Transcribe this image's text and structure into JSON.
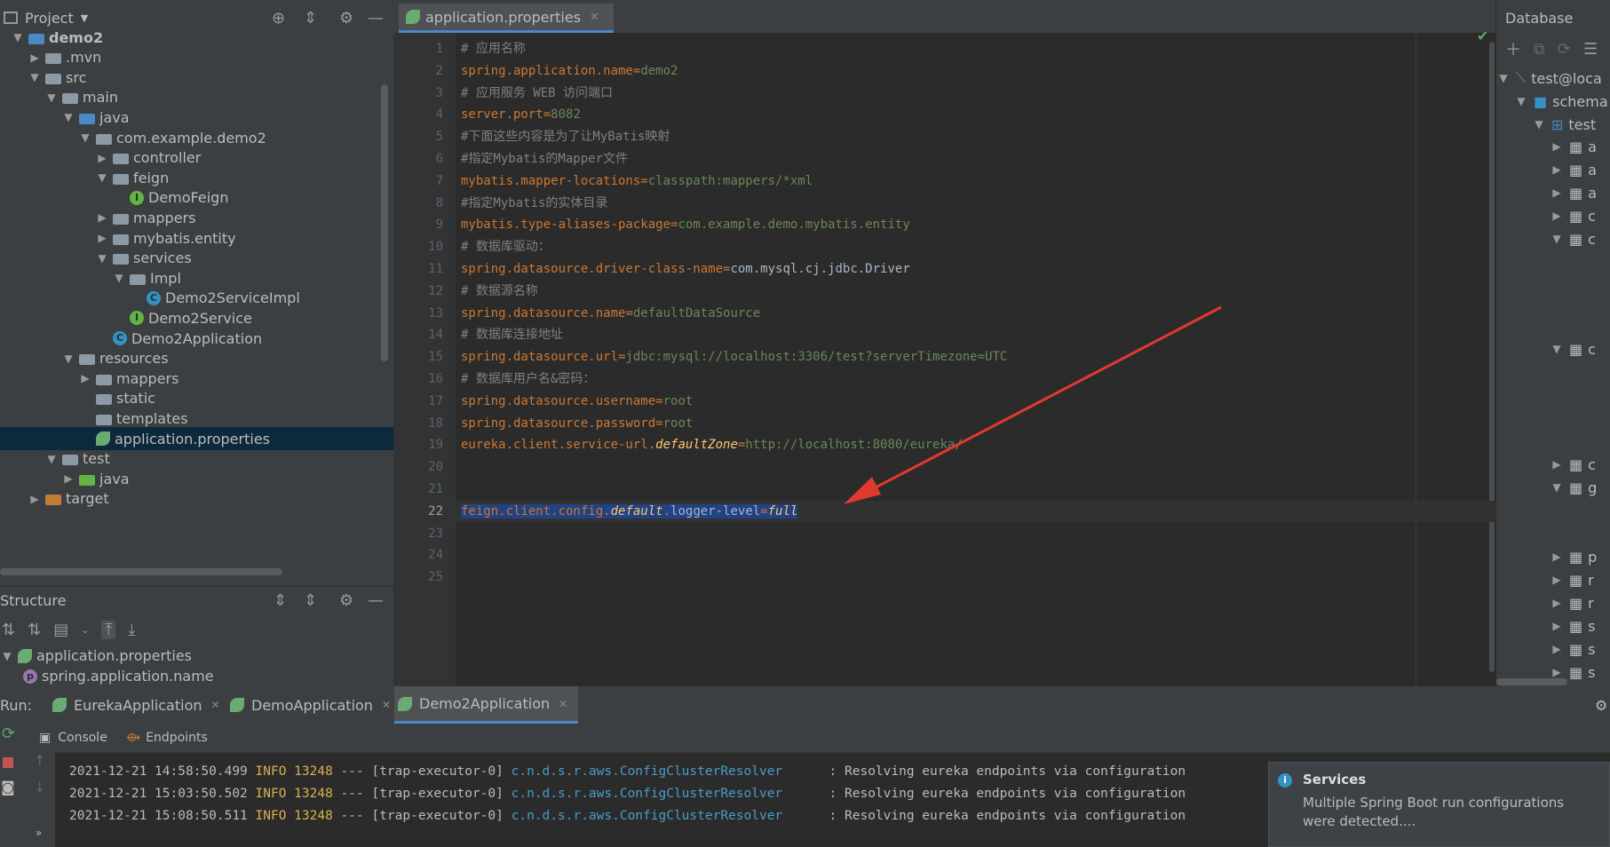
{
  "project": {
    "title": "Project",
    "tree": [
      {
        "label": "demo2",
        "indent": 0,
        "arrow": "down",
        "icon": "folder-blue",
        "bold": true
      },
      {
        "label": ".mvn",
        "indent": 1,
        "arrow": "right",
        "icon": "folder"
      },
      {
        "label": "src",
        "indent": 1,
        "arrow": "down",
        "icon": "folder"
      },
      {
        "label": "main",
        "indent": 2,
        "arrow": "down",
        "icon": "folder"
      },
      {
        "label": "java",
        "indent": 3,
        "arrow": "down",
        "icon": "folder-blue"
      },
      {
        "label": "com.example.demo2",
        "indent": 4,
        "arrow": "down",
        "icon": "package"
      },
      {
        "label": "controller",
        "indent": 5,
        "arrow": "right",
        "icon": "package"
      },
      {
        "label": "feign",
        "indent": 5,
        "arrow": "down",
        "icon": "package"
      },
      {
        "label": "DemoFeign",
        "indent": 6,
        "arrow": "",
        "icon": "interface"
      },
      {
        "label": "mappers",
        "indent": 5,
        "arrow": "right",
        "icon": "package"
      },
      {
        "label": "mybatis.entity",
        "indent": 5,
        "arrow": "right",
        "icon": "package"
      },
      {
        "label": "services",
        "indent": 5,
        "arrow": "down",
        "icon": "package"
      },
      {
        "label": "Impl",
        "indent": 6,
        "arrow": "down",
        "icon": "package"
      },
      {
        "label": "Demo2ServiceImpl",
        "indent": 7,
        "arrow": "",
        "icon": "class"
      },
      {
        "label": "Demo2Service",
        "indent": 6,
        "arrow": "",
        "icon": "interface"
      },
      {
        "label": "Demo2Application",
        "indent": 5,
        "arrow": "",
        "icon": "spring-class"
      },
      {
        "label": "resources",
        "indent": 3,
        "arrow": "down",
        "icon": "folder"
      },
      {
        "label": "mappers",
        "indent": 4,
        "arrow": "right",
        "icon": "folder"
      },
      {
        "label": "static",
        "indent": 4,
        "arrow": "",
        "icon": "folder"
      },
      {
        "label": "templates",
        "indent": 4,
        "arrow": "",
        "icon": "folder"
      },
      {
        "label": "application.properties",
        "indent": 4,
        "arrow": "",
        "icon": "spring-props",
        "selected": true
      },
      {
        "label": "test",
        "indent": 2,
        "arrow": "down",
        "icon": "folder"
      },
      {
        "label": "java",
        "indent": 3,
        "arrow": "right",
        "icon": "folder-green"
      },
      {
        "label": "target",
        "indent": 1,
        "arrow": "right",
        "icon": "folder-orange"
      }
    ]
  },
  "structure": {
    "title": "Structure",
    "items": [
      {
        "label": "application.properties",
        "icon": "spring-props"
      },
      {
        "label": "spring.application.name",
        "icon": "property"
      }
    ]
  },
  "editor": {
    "tab": "application.properties",
    "current_line": 22,
    "line_count": 25,
    "lines": [
      {
        "n": 1,
        "parts": [
          {
            "t": "# 应用名称",
            "c": "com"
          }
        ]
      },
      {
        "n": 2,
        "parts": [
          {
            "t": "spring.application.name",
            "c": "key"
          },
          {
            "t": "=",
            "c": "eq"
          },
          {
            "t": "demo2",
            "c": "val"
          }
        ]
      },
      {
        "n": 3,
        "parts": [
          {
            "t": "# 应用服务 WEB 访问端口",
            "c": "com"
          }
        ]
      },
      {
        "n": 4,
        "parts": [
          {
            "t": "server.port",
            "c": "key"
          },
          {
            "t": "=",
            "c": "eq"
          },
          {
            "t": "8082",
            "c": "val"
          }
        ]
      },
      {
        "n": 5,
        "parts": [
          {
            "t": "#下面这些内容是为了让MyBatis映射",
            "c": "com"
          }
        ]
      },
      {
        "n": 6,
        "parts": [
          {
            "t": "#指定Mybatis的Mapper文件",
            "c": "com"
          }
        ]
      },
      {
        "n": 7,
        "parts": [
          {
            "t": "mybatis.mapper-locations",
            "c": "key"
          },
          {
            "t": "=",
            "c": "eq"
          },
          {
            "t": "classpath:mappers/*xml",
            "c": "val"
          }
        ]
      },
      {
        "n": 8,
        "parts": [
          {
            "t": "#指定Mybatis的实体目录",
            "c": "com"
          }
        ]
      },
      {
        "n": 9,
        "parts": [
          {
            "t": "mybatis.type-aliases-package",
            "c": "key"
          },
          {
            "t": "=",
            "c": "eq"
          },
          {
            "t": "com.example.demo.mybatis.entity",
            "c": "val"
          }
        ]
      },
      {
        "n": 10,
        "parts": [
          {
            "t": "# 数据库驱动：",
            "c": "com"
          }
        ]
      },
      {
        "n": 11,
        "parts": [
          {
            "t": "spring.datasource.driver-class-name",
            "c": "key"
          },
          {
            "t": "=",
            "c": "eq"
          },
          {
            "t": "com.mysql.cj.jdbc.Driver",
            "c": "plain"
          }
        ]
      },
      {
        "n": 12,
        "parts": [
          {
            "t": "# 数据源名称",
            "c": "com"
          }
        ]
      },
      {
        "n": 13,
        "parts": [
          {
            "t": "spring.datasource.name",
            "c": "key"
          },
          {
            "t": "=",
            "c": "eq"
          },
          {
            "t": "defaultDataSource",
            "c": "val"
          }
        ]
      },
      {
        "n": 14,
        "parts": [
          {
            "t": "# 数据库连接地址",
            "c": "com"
          }
        ]
      },
      {
        "n": 15,
        "parts": [
          {
            "t": "spring.datasource.url",
            "c": "key"
          },
          {
            "t": "=",
            "c": "eq"
          },
          {
            "t": "jdbc:mysql://localhost:3306/test?serverTimezone=UTC",
            "c": "val"
          }
        ]
      },
      {
        "n": 16,
        "parts": [
          {
            "t": "# 数据库用户名&密码：",
            "c": "com"
          }
        ]
      },
      {
        "n": 17,
        "parts": [
          {
            "t": "spring.datasource.username",
            "c": "key"
          },
          {
            "t": "=",
            "c": "eq"
          },
          {
            "t": "root",
            "c": "val"
          }
        ]
      },
      {
        "n": 18,
        "parts": [
          {
            "t": "spring.datasource.password",
            "c": "key"
          },
          {
            "t": "=",
            "c": "eq"
          },
          {
            "t": "root",
            "c": "val"
          }
        ]
      },
      {
        "n": 19,
        "parts": [
          {
            "t": "eureka.client.service-url.",
            "c": "key"
          },
          {
            "t": "defaultZone",
            "c": "it"
          },
          {
            "t": "=",
            "c": "eq"
          },
          {
            "t": "http://localhost:8080/eureka/",
            "c": "val"
          }
        ]
      },
      {
        "n": 20,
        "parts": []
      },
      {
        "n": 21,
        "parts": []
      },
      {
        "n": 22,
        "selected": true,
        "parts": [
          {
            "t": "feign.client.config.",
            "c": "key"
          },
          {
            "t": "default",
            "c": "it"
          },
          {
            "t": ".",
            "c": "key"
          },
          {
            "t": "logger-level",
            "c": "plain"
          },
          {
            "t": "=",
            "c": "eq"
          },
          {
            "t": "full",
            "c": "it"
          }
        ]
      },
      {
        "n": 23,
        "parts": []
      },
      {
        "n": 24,
        "parts": []
      },
      {
        "n": 25,
        "parts": []
      }
    ]
  },
  "database": {
    "title": "Database",
    "connection": "test@loca",
    "schemas": "schema",
    "schema": "test",
    "tables": [
      "a",
      "a",
      "a",
      "c",
      "c",
      "c",
      "c",
      "g",
      "p",
      "r",
      "r",
      "s",
      "s",
      "s"
    ]
  },
  "run": {
    "label": "Run:",
    "tabs": [
      "EurekaApplication",
      "DemoApplication",
      "Demo2Application"
    ],
    "active_tab": "Demo2Application",
    "subtabs": [
      "Console",
      "Endpoints"
    ],
    "logs": [
      {
        "ts": "2021-12-21 14:58:50.499",
        "level": "INFO",
        "pid": "13248",
        "rest": " --- [trap-executor-0] ",
        "cls": "c.n.d.s.r.aws.ConfigClusterResolver",
        "msg": "      : Resolving eureka endpoints via configuration"
      },
      {
        "ts": "2021-12-21 15:03:50.502",
        "level": "INFO",
        "pid": "13248",
        "rest": " --- [trap-executor-0] ",
        "cls": "c.n.d.s.r.aws.ConfigClusterResolver",
        "msg": "      : Resolving eureka endpoints via configuration"
      },
      {
        "ts": "2021-12-21 15:08:50.511",
        "level": "INFO",
        "pid": "13248",
        "rest": " --- [trap-executor-0] ",
        "cls": "c.n.d.s.r.aws.ConfigClusterResolver",
        "msg": "      : Resolving eureka endpoints via configuration"
      }
    ]
  },
  "notification": {
    "title": "Services",
    "text1": "Multiple Spring Boot run configurations",
    "text2": "were detected...."
  },
  "colors": {
    "accent": "#4a88c7",
    "selection": "#214283",
    "arrow": "#e03a2f"
  }
}
